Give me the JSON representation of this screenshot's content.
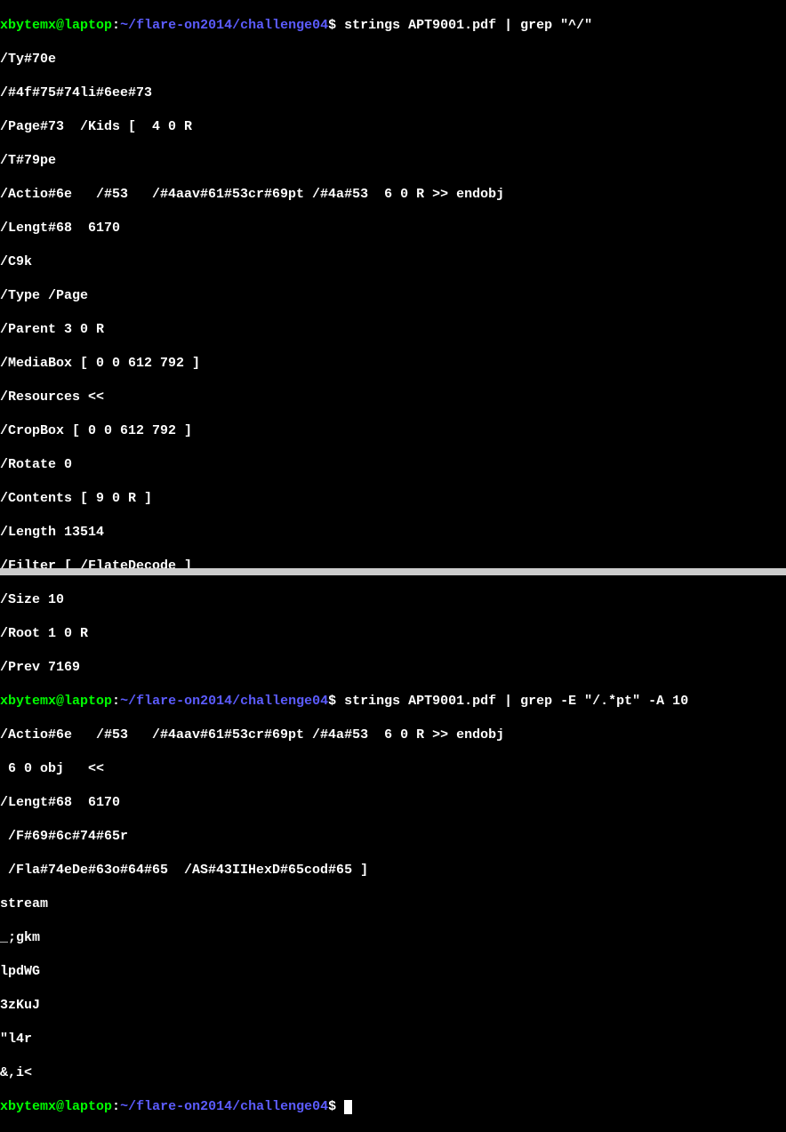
{
  "prompt1": {
    "user": "xbytemx",
    "at": "@",
    "host": "laptop",
    "colon": ":",
    "path": "~/flare-on2014/challenge04",
    "dollar": "$",
    "command": " strings APT9001.pdf | grep \"^/\""
  },
  "output1": {
    "l1": "/Ty#70e",
    "l2": "/#4f#75#74li#6ee#73",
    "l3": "/Page#73  /Kids [  4 0 R",
    "l4": "/T#79pe",
    "l5": "/Actio#6e   /#53   /#4aav#61#53cr#69pt /#4a#53  6 0 R >> endobj",
    "l6": "/Lengt#68  6170",
    "l7": "/C9k",
    "l8": "/Type /Page",
    "l9": "/Parent 3 0 R",
    "l10": "/MediaBox [ 0 0 612 792 ]",
    "l11": "/Resources <<",
    "l12": "/CropBox [ 0 0 612 792 ]",
    "l13": "/Rotate 0",
    "l14": "/Contents [ 9 0 R ]",
    "l15": "/Length 13514",
    "l16": "/Filter [ /FlateDecode ]",
    "l17": "/Size 10",
    "l18": "/Root 1 0 R",
    "l19": "/Prev 7169"
  },
  "prompt2": {
    "user": "xbytemx",
    "at": "@",
    "host": "laptop",
    "colon": ":",
    "path": "~/flare-on2014/challenge04",
    "dollar": "$",
    "command": " strings APT9001.pdf | grep -E \"/.*pt\" -A 10"
  },
  "output2": {
    "l1": "/Actio#6e   /#53   /#4aav#61#53cr#69pt /#4a#53  6 0 R >> endobj",
    "l2": " 6 0 obj   <<",
    "l3": "/Lengt#68  6170",
    "l4": " /F#69#6c#74#65r",
    "l5": " /Fla#74eDe#63o#64#65  /AS#43IIHexD#65cod#65 ]",
    "l6": "stream",
    "l7": "_;gkm",
    "l8": "lpdWG",
    "l9": "3zKuJ",
    "l10": "\"l4r",
    "l11": "&,i<"
  },
  "prompt3": {
    "user": "xbytemx",
    "at": "@",
    "host": "laptop",
    "colon": ":",
    "path": "~/flare-on2014/challenge04",
    "dollar": "$",
    "command": " "
  }
}
